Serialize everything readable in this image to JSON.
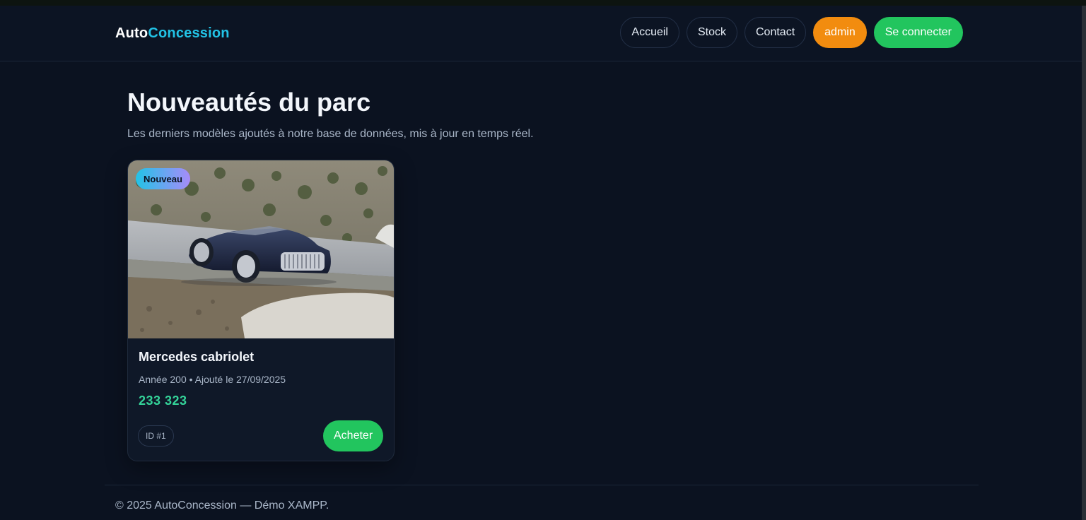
{
  "brand": {
    "part1": "Auto",
    "part2": "Concession"
  },
  "nav": {
    "home": "Accueil",
    "stock": "Stock",
    "contact": "Contact",
    "user": "admin",
    "login": "Se connecter"
  },
  "main": {
    "title": "Nouveautés du parc",
    "subtitle": "Les derniers modèles ajoutés à notre base de données, mis à jour en temps réel."
  },
  "card": {
    "badge": "Nouveau",
    "title": "Mercedes cabriolet",
    "meta": "Année 200 • Ajouté le 27/09/2025",
    "price": "233 323",
    "id": "ID #1",
    "buy": "Acheter"
  },
  "footer": {
    "text": "© 2025 AutoConcession — Démo XAMPP."
  },
  "colors": {
    "background": "#0b1220",
    "accent_cyan": "#22c3e6",
    "admin_orange": "#f28c0f",
    "primary_green": "#22c55e",
    "price_green": "#34d399"
  }
}
